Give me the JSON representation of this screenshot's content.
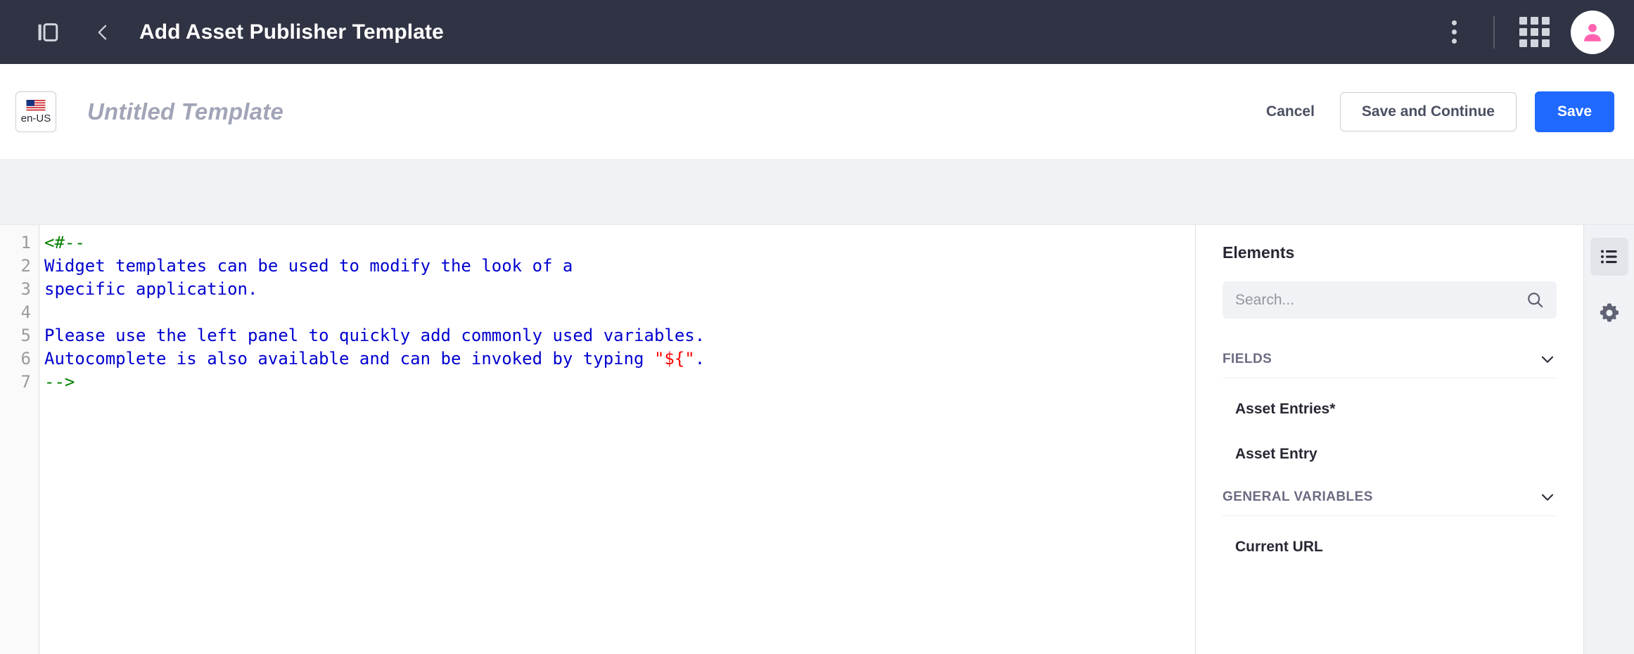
{
  "navbar": {
    "sidebar_toggle_icon": "panel-toggle-icon",
    "back_icon": "chevron-left-icon",
    "title": "Add Asset Publisher Template",
    "more_icon": "vertical-dots-icon",
    "apps_icon": "apps-grid-icon",
    "avatar_icon": "user-avatar-icon",
    "background": "#303343",
    "avatar_color": "#ff62b0"
  },
  "toolbar": {
    "locale_label": "en-US",
    "locale_flag_icon": "us-flag-icon",
    "template_title_placeholder": "Untitled Template",
    "cancel_label": "Cancel",
    "save_continue_label": "Save and Continue",
    "save_label": "Save",
    "primary_color": "#1f69ff"
  },
  "editor": {
    "line_numbers": [
      "1",
      "2",
      "3",
      "4",
      "5",
      "6",
      "7"
    ],
    "lines": [
      [
        {
          "t": "<#--",
          "c": "comment"
        }
      ],
      [
        {
          "t": "Widget templates can be used to modify the look of a",
          "c": "text"
        }
      ],
      [
        {
          "t": "specific application.",
          "c": "text"
        }
      ],
      [
        {
          "t": "",
          "c": "text"
        }
      ],
      [
        {
          "t": "Please use the left panel to quickly add commonly used variables.",
          "c": "text"
        }
      ],
      [
        {
          "t": "Autocomplete is also available and can be invoked by typing ",
          "c": "text"
        },
        {
          "t": "\"${\"",
          "c": "string"
        },
        {
          "t": ".",
          "c": "text"
        }
      ],
      [
        {
          "t": "-->",
          "c": "comment"
        }
      ]
    ],
    "colors": {
      "comment": "#008000",
      "text": "#0000d0",
      "string": "#ff0000"
    }
  },
  "panel": {
    "title": "Elements",
    "search": {
      "value": "",
      "placeholder": "Search...",
      "icon": "search-icon"
    },
    "sections": [
      {
        "label": "FIELDS",
        "chevron_icon": "chevron-down-icon",
        "items": [
          "Asset Entries*",
          "Asset Entry"
        ]
      },
      {
        "label": "GENERAL VARIABLES",
        "chevron_icon": "chevron-down-icon",
        "items": [
          "Current URL"
        ]
      }
    ]
  },
  "rail": {
    "items": [
      {
        "icon": "list-icon",
        "active": true
      },
      {
        "icon": "gear-icon",
        "active": false
      }
    ]
  }
}
